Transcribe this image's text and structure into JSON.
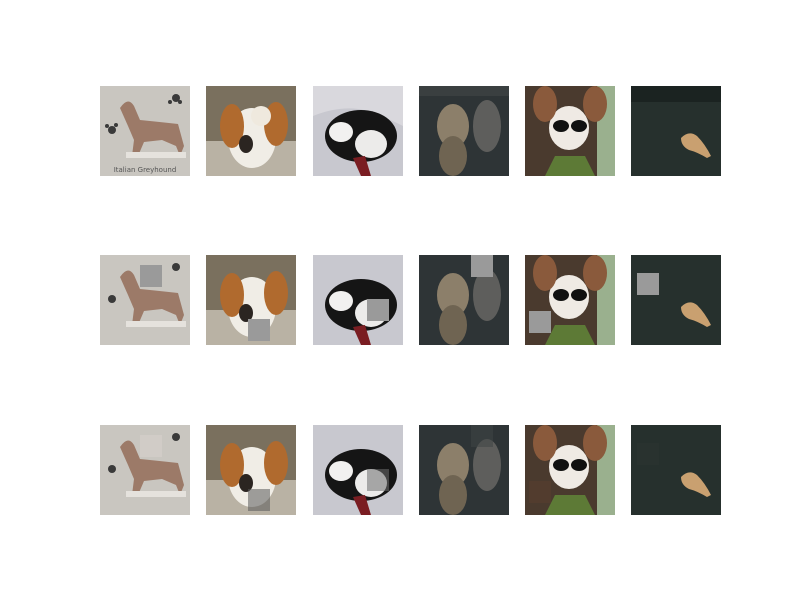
{
  "figure": {
    "rows": [
      {
        "row": "original"
      },
      {
        "row": "masked"
      },
      {
        "row": "reconstructed"
      }
    ],
    "images": [
      {
        "subject": "italian-greyhound",
        "caption": "Italian Greyhound",
        "mask": "upper-right-mid"
      },
      {
        "subject": "papillon-dog",
        "mask": "lower-mid"
      },
      {
        "subject": "black-white-dog-held",
        "mask": "mid-right"
      },
      {
        "subject": "tabby-cat-dark",
        "mask": "top-right"
      },
      {
        "subject": "chihuahua-sunglasses",
        "mask": "lower-left"
      },
      {
        "subject": "small-animal-dark",
        "mask": "upper-left"
      }
    ]
  }
}
